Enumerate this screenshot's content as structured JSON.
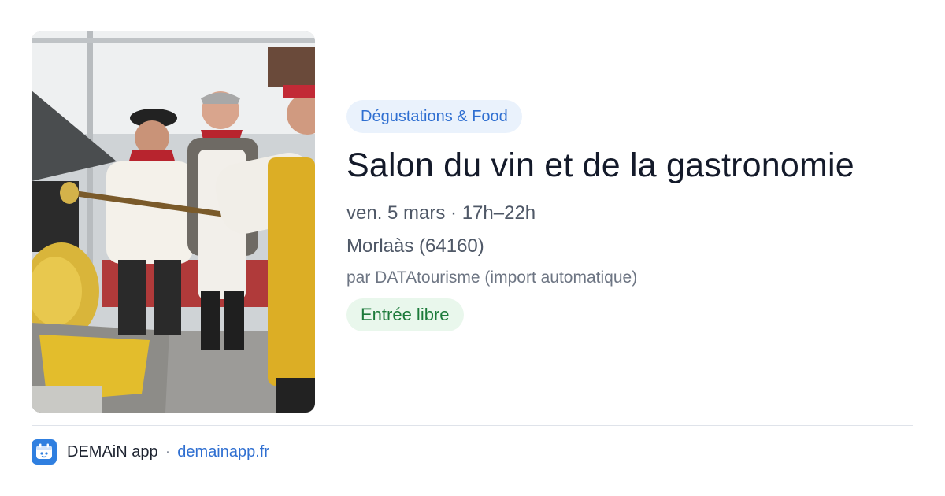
{
  "event": {
    "photo_alt": "",
    "category": "Dégustations & Food",
    "title": "Salon du vin et de la gastronomie",
    "when": "ven. 5 mars · 17h–22h",
    "where": "Morlaàs (64160)",
    "organizer": "par DATAtourisme (import automatique)",
    "price": "Entrée libre"
  },
  "footer": {
    "app_name": "DEMAiN app",
    "separator": "·",
    "link_text": "demainapp.fr",
    "app_icon": "app-logo-icon"
  },
  "colors": {
    "category_bg": "#eaf2fc",
    "category_text": "#2f6fd1",
    "price_bg": "#e9f7ec",
    "price_text": "#1c7a3a",
    "title_text": "#141a2a",
    "link": "#2f6fd1",
    "app_icon_bg": "#2f7fe0"
  }
}
